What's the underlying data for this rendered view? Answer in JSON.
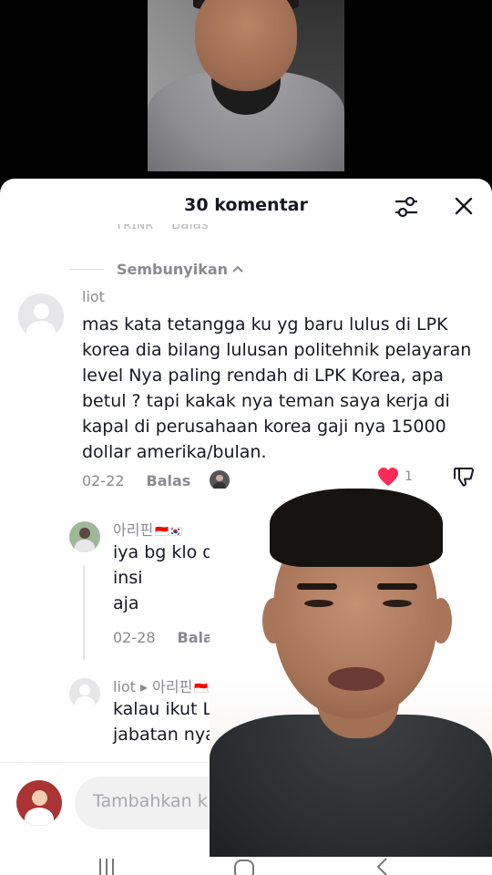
{
  "sheet": {
    "title": "30 komentar",
    "cut_left": "Ƭʀɪɴʀ",
    "cut_right": "Balas",
    "hide_label": "Sembunyikan"
  },
  "comments": [
    {
      "user": "liot",
      "text": "mas kata tetangga ku yg baru lulus di LPK korea dia bilang lulusan politehnik pelayaran level Nya paling rendah di LPK Korea, apa betul ? tapi kakak nya teman saya kerja di kapal di perusahaan korea gaji nya 15000 dollar amerika/bulan.",
      "date": "02-22",
      "reply_label": "Balas",
      "likes": "1"
    }
  ],
  "replies": [
    {
      "user": "아리핀",
      "flags": "🇮🇩🇰🇷",
      "text": "iya bg klo di indo             atau bos atau insi                         a level nya sama aja                        s",
      "date": "02-28",
      "reply_label": "Balas"
    },
    {
      "user": "liot ▸ 아리핀",
      "flags": "🇮🇩🇰🇷",
      "text": "kalau ikut LPK korea                korea jabatan nya apa"
    }
  ],
  "input": {
    "placeholder": "Tambahkan k"
  },
  "colors": {
    "like_red": "#fe2c55",
    "text_primary": "#161823",
    "text_secondary": "#8a8b91"
  },
  "icons": [
    "filter-icon",
    "close-icon",
    "chevron-up-icon",
    "heart-icon",
    "dislike-icon",
    "recent-apps-icon",
    "home-icon",
    "back-icon"
  ]
}
